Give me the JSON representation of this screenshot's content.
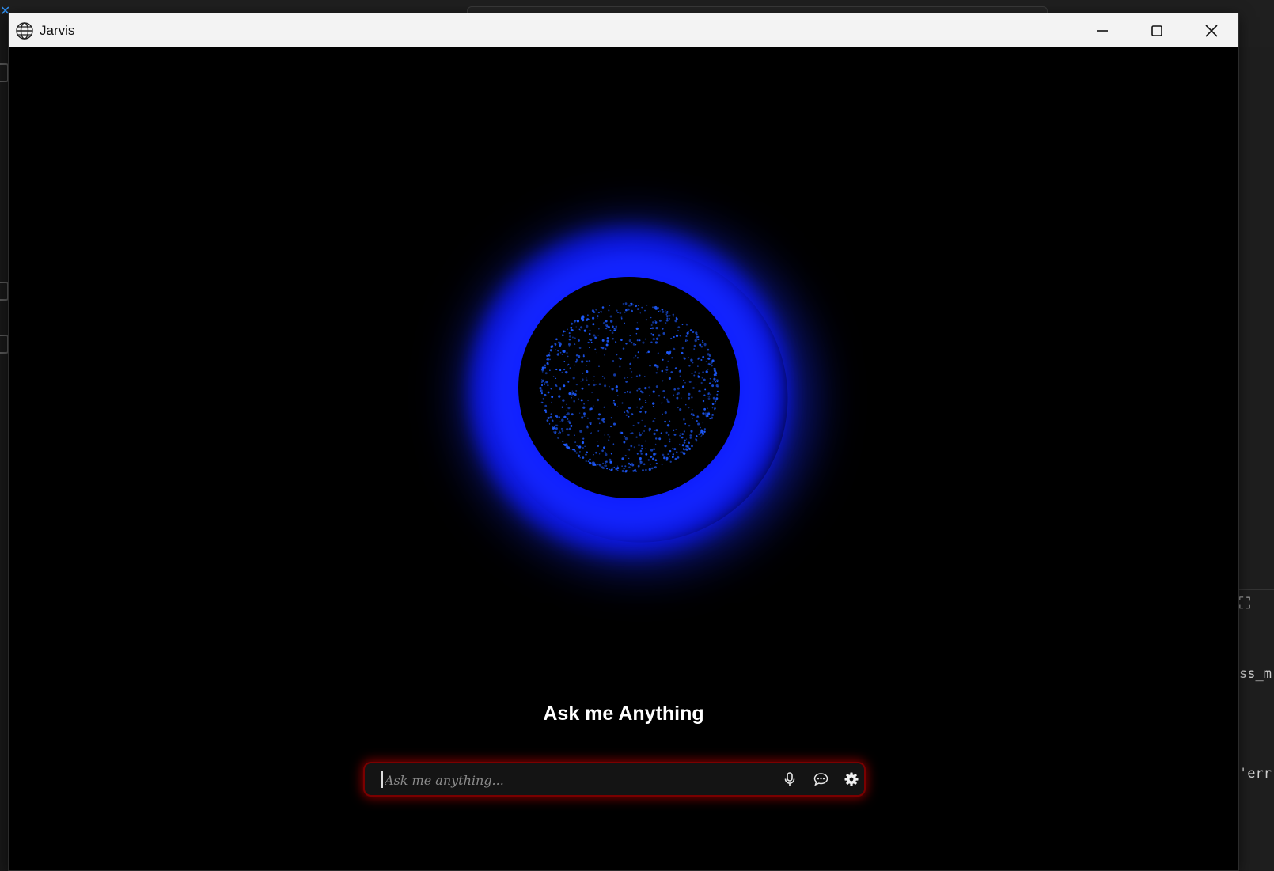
{
  "window": {
    "title": "Jarvis"
  },
  "main": {
    "heading": "Ask me Anything",
    "input": {
      "placeholder": "Ask me anything...",
      "value": ""
    },
    "icons": [
      "microphone-icon",
      "chat-icon",
      "settings-icon"
    ]
  },
  "background_editor": {
    "code_fragments": [
      "ss_m",
      "'err"
    ]
  },
  "colors": {
    "orb_glow": "#1426ff",
    "particles": "#1e5bff",
    "input_border_glow": "#c80000",
    "background": "#000000"
  }
}
